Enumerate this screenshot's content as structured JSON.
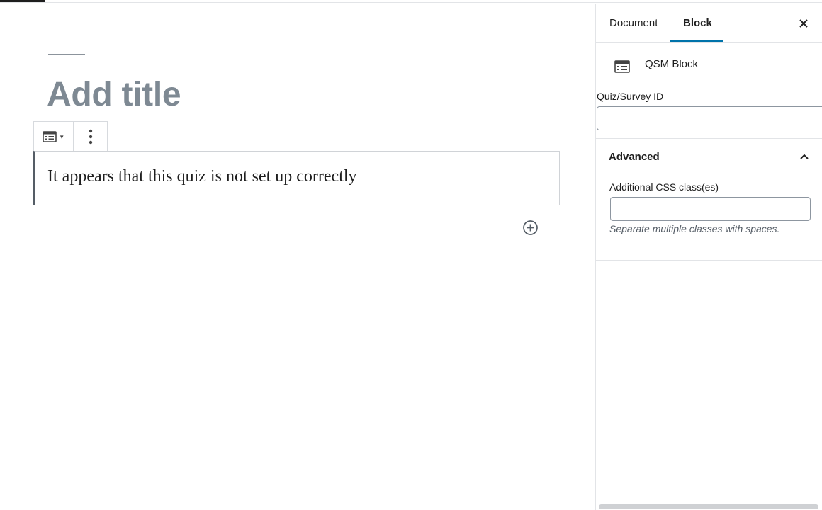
{
  "editor": {
    "title_placeholder": "Add title",
    "block_message": "It appears that this quiz is not set up correctly",
    "toolbar": {
      "switcher_icon": "form-block-icon",
      "more_icon": "more-vertical-icon"
    },
    "inserter_icon": "add-circle-icon"
  },
  "sidebar": {
    "tabs": [
      {
        "label": "Document",
        "active": false
      },
      {
        "label": "Block",
        "active": true
      }
    ],
    "close_icon": "close-icon",
    "block_card": {
      "icon": "form-block-icon",
      "title": "QSM Block"
    },
    "quiz_id": {
      "label": "Quiz/Survey ID",
      "value": ""
    },
    "advanced": {
      "title": "Advanced",
      "expanded": true,
      "css_label": "Additional CSS class(es)",
      "css_value": "",
      "help_text": "Separate multiple classes with spaces."
    }
  },
  "colors": {
    "accent": "#0073aa",
    "title_placeholder": "#7e8993",
    "border": "#e2e4e7"
  }
}
